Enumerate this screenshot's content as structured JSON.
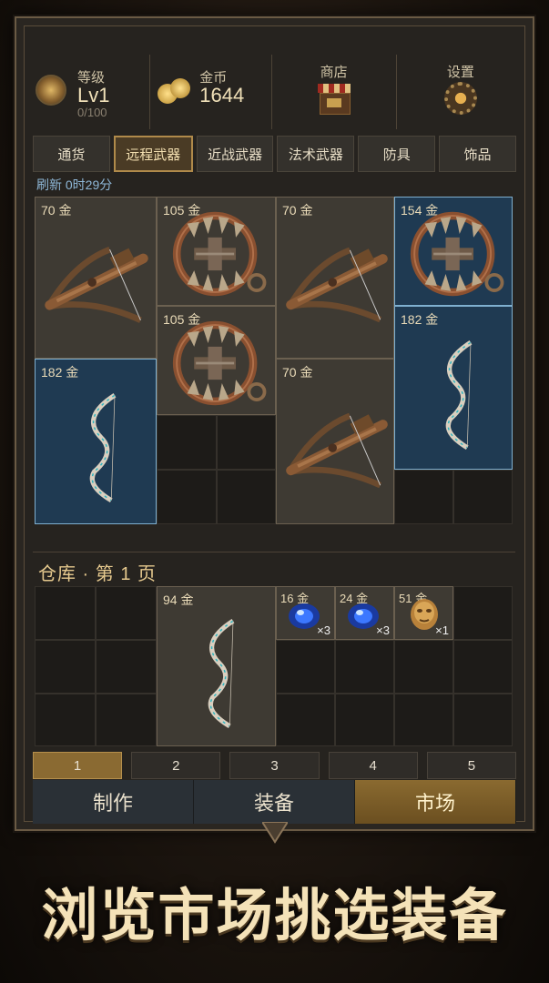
{
  "header": {
    "level": {
      "label": "等级",
      "value": "Lv1",
      "progress": "0/100",
      "progress_fraction": 0
    },
    "gold": {
      "label": "金币",
      "value": "1644"
    },
    "shop": {
      "label": "商店"
    },
    "settings": {
      "label": "设置"
    }
  },
  "tabs": [
    "通货",
    "远程武器",
    "近战武器",
    "法术武器",
    "防具",
    "饰品"
  ],
  "active_tab": "远程武器",
  "refresh": "刷新 0时29分",
  "market_items": [
    {
      "price": "70 金",
      "icon": "crossbow-icon"
    },
    {
      "price": "105 金",
      "icon": "bear-trap-icon"
    },
    {
      "price": "70 金",
      "icon": "crossbow-icon"
    },
    {
      "price": "154 金",
      "icon": "bear-trap-icon"
    },
    {
      "price": "105 金",
      "icon": "bear-trap-icon"
    },
    {
      "price": "182 金",
      "icon": "bow-icon"
    },
    {
      "price": "182 金",
      "icon": "bow-icon"
    },
    {
      "price": "70 金",
      "icon": "crossbow-icon"
    }
  ],
  "warehouse": {
    "title": "仓库 · 第 1 页",
    "items": [
      {
        "price": "94 金",
        "icon": "bow-icon",
        "qty": ""
      },
      {
        "price": "16 金",
        "icon": "blue-orb-icon",
        "qty": "×3"
      },
      {
        "price": "24 金",
        "icon": "blue-orb-icon",
        "qty": "×3"
      },
      {
        "price": "51 金",
        "icon": "golden-mask-icon",
        "qty": "×1"
      }
    ]
  },
  "pages": [
    "1",
    "2",
    "3",
    "4",
    "5"
  ],
  "active_page": "1",
  "bottom_nav": [
    "制作",
    "装备",
    "市场"
  ],
  "active_nav": "市场",
  "tagline": "浏览市场挑选装备",
  "colors": {
    "accent_gold": "#b08a4a",
    "blue_highlight": "#7fb0d0",
    "active_nav": "#8a6a30"
  }
}
